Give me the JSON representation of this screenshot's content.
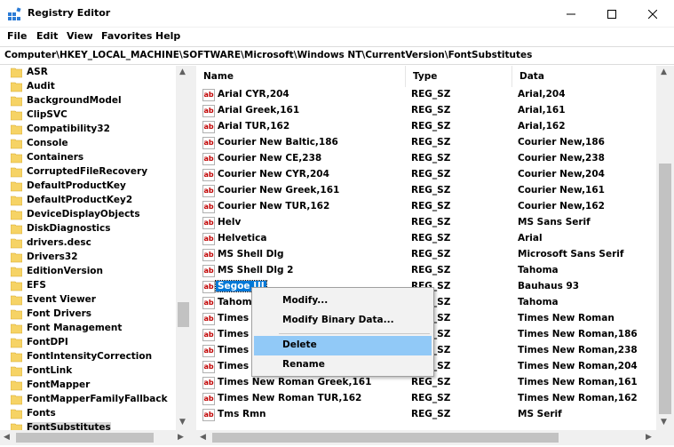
{
  "window": {
    "title": "Registry Editor"
  },
  "menu": [
    "File",
    "Edit",
    "View",
    "Favorites",
    "Help"
  ],
  "address": "Computer\\HKEY_LOCAL_MACHINE\\SOFTWARE\\Microsoft\\Windows NT\\CurrentVersion\\FontSubstitutes",
  "tree": {
    "items": [
      "ASR",
      "Audit",
      "BackgroundModel",
      "ClipSVC",
      "Compatibility32",
      "Console",
      "Containers",
      "CorruptedFileRecovery",
      "DefaultProductKey",
      "DefaultProductKey2",
      "DeviceDisplayObjects",
      "DiskDiagnostics",
      "drivers.desc",
      "Drivers32",
      "EditionVersion",
      "EFS",
      "Event Viewer",
      "Font Drivers",
      "Font Management",
      "FontDPI",
      "FontIntensityCorrection",
      "FontLink",
      "FontMapper",
      "FontMapperFamilyFallback",
      "Fonts",
      "FontSubstitutes"
    ],
    "selected": "FontSubstitutes"
  },
  "columns": {
    "name": "Name",
    "type": "Type",
    "data": "Data"
  },
  "values": [
    {
      "name": "Arial CYR,204",
      "type": "REG_SZ",
      "data": "Arial,204"
    },
    {
      "name": "Arial Greek,161",
      "type": "REG_SZ",
      "data": "Arial,161"
    },
    {
      "name": "Arial TUR,162",
      "type": "REG_SZ",
      "data": "Arial,162"
    },
    {
      "name": "Courier New Baltic,186",
      "type": "REG_SZ",
      "data": "Courier New,186"
    },
    {
      "name": "Courier New CE,238",
      "type": "REG_SZ",
      "data": "Courier New,238"
    },
    {
      "name": "Courier New CYR,204",
      "type": "REG_SZ",
      "data": "Courier New,204"
    },
    {
      "name": "Courier New Greek,161",
      "type": "REG_SZ",
      "data": "Courier New,161"
    },
    {
      "name": "Courier New TUR,162",
      "type": "REG_SZ",
      "data": "Courier New,162"
    },
    {
      "name": "Helv",
      "type": "REG_SZ",
      "data": "MS Sans Serif"
    },
    {
      "name": "Helvetica",
      "type": "REG_SZ",
      "data": "Arial"
    },
    {
      "name": "MS Shell Dlg",
      "type": "REG_SZ",
      "data": "Microsoft Sans Serif"
    },
    {
      "name": "MS Shell Dlg 2",
      "type": "REG_SZ",
      "data": "Tahoma"
    },
    {
      "name": "Segoe UI",
      "type": "REG_SZ",
      "data": "Bauhaus 93"
    },
    {
      "name": "Tahoma",
      "type": "REG_SZ",
      "data": "Tahoma"
    },
    {
      "name": "Times",
      "type": "REG_SZ",
      "data": "Times New Roman"
    },
    {
      "name": "Times New Roman Baltic,186",
      "type": "REG_SZ",
      "data": "Times New Roman,186"
    },
    {
      "name": "Times New Roman CE,238",
      "type": "REG_SZ",
      "data": "Times New Roman,238"
    },
    {
      "name": "Times New Roman CYR,204",
      "type": "REG_SZ",
      "data": "Times New Roman,204"
    },
    {
      "name": "Times New Roman Greek,161",
      "type": "REG_SZ",
      "data": "Times New Roman,161"
    },
    {
      "name": "Times New Roman TUR,162",
      "type": "REG_SZ",
      "data": "Times New Roman,162"
    },
    {
      "name": "Tms Rmn",
      "type": "REG_SZ",
      "data": "MS Serif"
    }
  ],
  "selected_value": "Segoe UI",
  "context_menu": {
    "items": [
      "Modify...",
      "Modify Binary Data...",
      "Delete",
      "Rename"
    ],
    "highlighted": "Delete"
  },
  "icons": {
    "app": "registry-editor-icon",
    "folder": "folder-icon",
    "value": "ab-string-value-icon"
  },
  "colors": {
    "selection": "#0078d7",
    "menu_highlight": "#91c9f7",
    "folder": "#f6d365",
    "string_icon": "#c00000"
  }
}
